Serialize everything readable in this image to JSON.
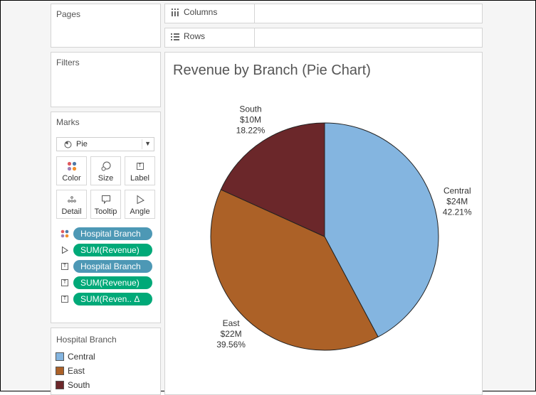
{
  "panels": {
    "pages": "Pages",
    "filters": "Filters",
    "marks": "Marks"
  },
  "shelves": {
    "columns": "Columns",
    "rows": "Rows"
  },
  "marks": {
    "mark_type": "Pie",
    "buttons": [
      "Color",
      "Size",
      "Label",
      "Detail",
      "Tooltip",
      "Angle"
    ],
    "pills": [
      {
        "label": "Hospital Branch",
        "kind": "dimension",
        "icon": "color-dots-icon"
      },
      {
        "label": "SUM(Revenue)",
        "kind": "measure",
        "icon": "angle-icon"
      },
      {
        "label": "Hospital Branch",
        "kind": "dimension",
        "icon": "label-text-icon"
      },
      {
        "label": "SUM(Revenue)",
        "kind": "measure",
        "icon": "label-text-icon"
      },
      {
        "label": "SUM(Reven.. Δ",
        "kind": "measure",
        "icon": "label-text-icon"
      }
    ]
  },
  "legend": {
    "title": "Hospital Branch",
    "items": [
      {
        "label": "Central",
        "color": "#84b5e0"
      },
      {
        "label": "East",
        "color": "#ac6127"
      },
      {
        "label": "South",
        "color": "#6b272a"
      }
    ]
  },
  "chart_data": {
    "type": "pie",
    "title": "Revenue by Branch (Pie Chart)",
    "slices": [
      {
        "name": "Central",
        "value_label": "$24M",
        "pct_label": "42.21%",
        "pct": 42.21,
        "color": "#84b5e0"
      },
      {
        "name": "East",
        "value_label": "$22M",
        "pct_label": "39.56%",
        "pct": 39.56,
        "color": "#ac6127"
      },
      {
        "name": "South",
        "value_label": "$10M",
        "pct_label": "18.22%",
        "pct": 18.22,
        "color": "#6b272a"
      }
    ]
  },
  "colors": {
    "dimension_pill": "#4d98b5",
    "measure_pill": "#00a978"
  }
}
